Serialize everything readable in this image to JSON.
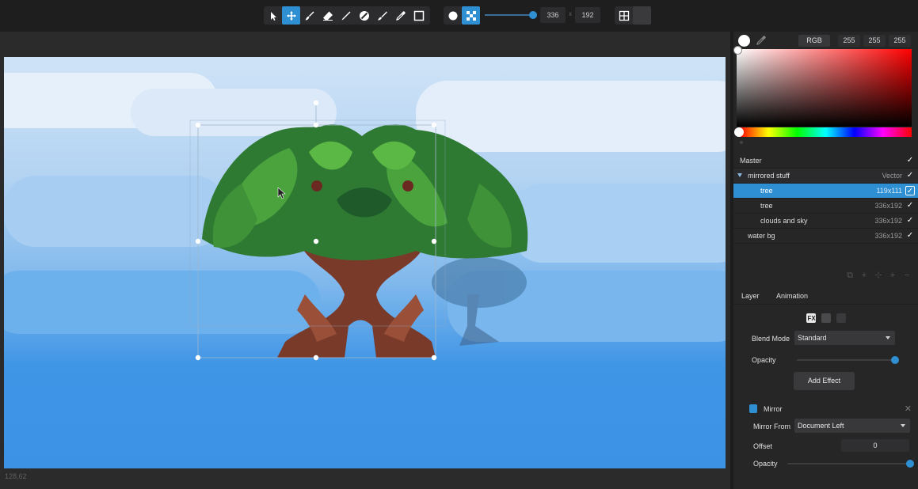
{
  "toolbar": {
    "tools": [
      {
        "name": "select-tool",
        "icon": "arrow-cursor-icon",
        "active": false
      },
      {
        "name": "move-tool",
        "icon": "move-arrows-icon",
        "active": true
      },
      {
        "name": "brush-tool",
        "icon": "brush-icon",
        "active": false
      },
      {
        "name": "eraser-tool",
        "icon": "eraser-icon",
        "active": false
      },
      {
        "name": "pen-tool",
        "icon": "pen-icon",
        "active": false
      },
      {
        "name": "fill-tool",
        "icon": "fill-icon",
        "active": false
      },
      {
        "name": "smudge-tool",
        "icon": "smudge-icon",
        "active": false
      },
      {
        "name": "picker-tool",
        "icon": "color-picker-icon",
        "active": false
      },
      {
        "name": "rect-select-tool",
        "icon": "rectangle-icon",
        "active": false
      }
    ],
    "width_value": "336",
    "height_value": "192",
    "times_symbol": "x",
    "size_slider_value": 0.92
  },
  "status": {
    "coords": "128,62"
  },
  "color_picker": {
    "mode": "RGB",
    "r": "255",
    "g": "255",
    "b": "255",
    "current_color": "#ffffff"
  },
  "layers": [
    {
      "name": "Master",
      "info": "",
      "indent": 0,
      "type": "root",
      "checked": true
    },
    {
      "name": "mirrored stuff",
      "info": "Vector",
      "indent": 1,
      "type": "group",
      "checked": true
    },
    {
      "name": "tree",
      "info": "119x111",
      "indent": 2,
      "type": "selected",
      "checked": true
    },
    {
      "name": "tree",
      "info": "336x192",
      "indent": 2,
      "type": "normal",
      "checked": true
    },
    {
      "name": "clouds and sky",
      "info": "336x192",
      "indent": 2,
      "type": "normal",
      "checked": true
    },
    {
      "name": "water bg",
      "info": "336x192",
      "indent": 1,
      "type": "normal",
      "checked": true
    }
  ],
  "properties": {
    "tabs": [
      "Layer",
      "Animation"
    ],
    "blend_mode_label": "Blend Mode",
    "blend_mode_value": "Standard",
    "opacity_label": "Opacity",
    "opacity_value": 1.0,
    "add_effect_label": "Add Effect",
    "effect": {
      "name": "Mirror",
      "mirror_from_label": "Mirror From",
      "mirror_from_value": "Document Left",
      "offset_label": "Offset",
      "offset_value": "0",
      "opacity_label": "Opacity",
      "opacity_value": 1.0
    }
  },
  "colors": {
    "accent": "#2f8fd3",
    "canvas_sky_top": "#cfe3f7",
    "canvas_sky_bottom": "#3c93e6"
  }
}
